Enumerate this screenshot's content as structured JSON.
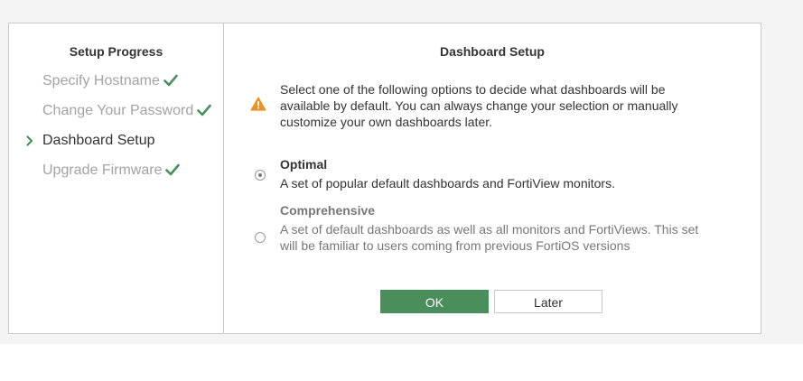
{
  "sidebar": {
    "title": "Setup Progress",
    "steps": [
      {
        "label": "Specify Hostname",
        "state": "done"
      },
      {
        "label": "Change Your Password",
        "state": "done"
      },
      {
        "label": "Dashboard Setup",
        "state": "current"
      },
      {
        "label": "Upgrade Firmware",
        "state": "done"
      }
    ]
  },
  "main": {
    "title": "Dashboard Setup",
    "intro": "Select one of the following options to decide what dashboards will be available by default. You can always change your selection or manually customize your own dashboards later.",
    "options": [
      {
        "title": "Optimal",
        "description": "A set of popular default dashboards and FortiView monitors.",
        "selected": true
      },
      {
        "title": "Comprehensive",
        "description": "A set of default dashboards as well as all monitors and FortiViews. This set will be familiar to users coming from previous FortiOS versions",
        "selected": false
      }
    ],
    "buttons": {
      "ok": "OK",
      "later": "Later"
    }
  },
  "icons": {
    "current_step": "chevron-right-icon",
    "done_step": "checkmark-icon",
    "warning": "warning-triangle-icon"
  },
  "colors": {
    "accent_green": "#4a8f5b",
    "warning_orange": "#e8922c",
    "muted_text": "#a3a3a3"
  }
}
